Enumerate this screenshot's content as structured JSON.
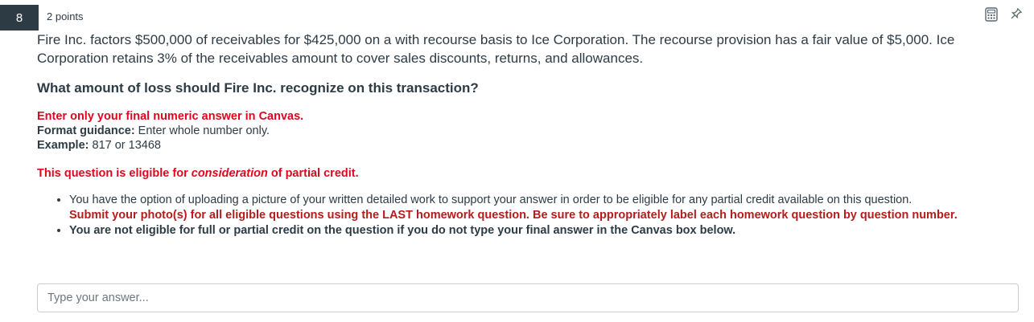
{
  "question": {
    "number": "8",
    "points": "2 points",
    "stem": "Fire Inc. factors $500,000 of receivables for $425,000 on a with recourse basis to Ice Corporation. The recourse provision has a fair value of $5,000. Ice Corporation retains 3% of the receivables amount to cover sales discounts, returns, and allowances.",
    "prompt": "What amount of loss should Fire Inc. recognize on this transaction?"
  },
  "instructions": {
    "final_answer": "Enter only your final numeric answer in Canvas.",
    "format_label": "Format guidance:",
    "format_text": " Enter whole number only.",
    "example_label": "Example:",
    "example_text": " 817 or 13468"
  },
  "partial_credit": {
    "prefix": "This question is eligible for ",
    "emphasis": "consideration",
    "suffix": " of partial credit."
  },
  "bullets": {
    "upload_text": "You have the option of uploading a picture of your written detailed work to support your answer in order to be eligible for any partial credit available on this question.",
    "submit_text": "Submit your photo(s) for all eligible questions using the LAST homework question. Be sure to appropriately label each homework question by question number.",
    "not_eligible_text": "You are not eligible for full or partial credit on the question if you do not type your final answer in the Canvas box below."
  },
  "answer_input": {
    "placeholder": "Type your answer...",
    "value": ""
  },
  "icons": [
    "calculator-icon",
    "pin-icon"
  ],
  "colors": {
    "question_number_bg": "#2d3b45",
    "emphasis_red": "#e0061f",
    "submit_red": "#b51c1c"
  }
}
